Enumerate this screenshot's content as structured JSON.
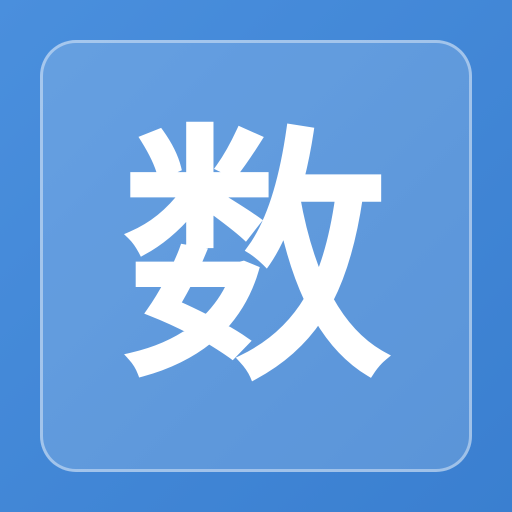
{
  "icon": {
    "glyph": "数",
    "colors": {
      "background_start": "#4a8fdd",
      "background_end": "#3a7fd0",
      "glyph": "#ffffff"
    }
  }
}
